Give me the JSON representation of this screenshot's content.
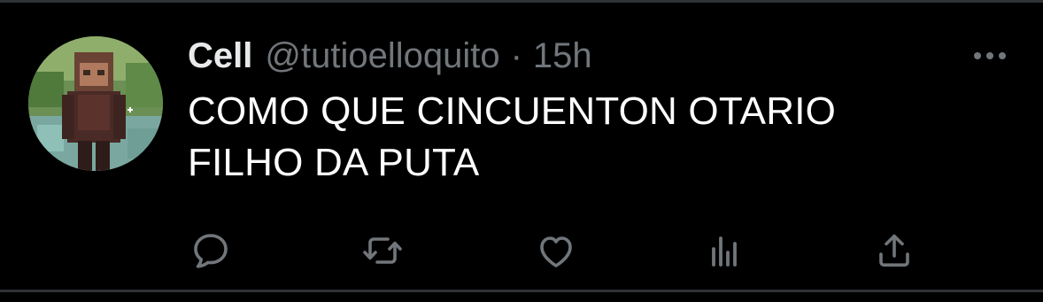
{
  "tweet": {
    "display_name": "Cell",
    "handle": "@tutioelloquito",
    "separator": "·",
    "time": "15h",
    "text_lines": [
      "COMO QUE CINCUENTON OTARIO",
      "FILHO DA PUTA"
    ]
  },
  "actions": {
    "icons": [
      "reply-icon",
      "retweet-icon",
      "like-icon",
      "analytics-icon",
      "share-icon"
    ]
  },
  "colors": {
    "background": "#000000",
    "text": "#ffffff",
    "secondary": "#71767b",
    "divider": "#2f3336"
  }
}
